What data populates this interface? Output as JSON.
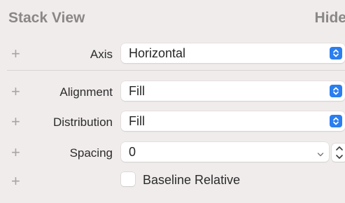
{
  "section": {
    "title": "Stack View",
    "hide_label": "Hide"
  },
  "rows": {
    "axis": {
      "label": "Axis",
      "value": "Horizontal"
    },
    "alignment": {
      "label": "Alignment",
      "value": "Fill"
    },
    "distribution": {
      "label": "Distribution",
      "value": "Fill"
    },
    "spacing": {
      "label": "Spacing",
      "value": "0"
    },
    "baseline": {
      "label": "Baseline Relative",
      "checked": false
    }
  },
  "plus_glyph": "+",
  "icons": {
    "plus": "plus-icon",
    "popup_arrows": "chevron-up-down-icon",
    "combo_arrow": "chevron-down-icon",
    "stepper": "stepper-icon"
  },
  "colors": {
    "accent": "#2a7ef0",
    "background": "#f1ecec"
  }
}
